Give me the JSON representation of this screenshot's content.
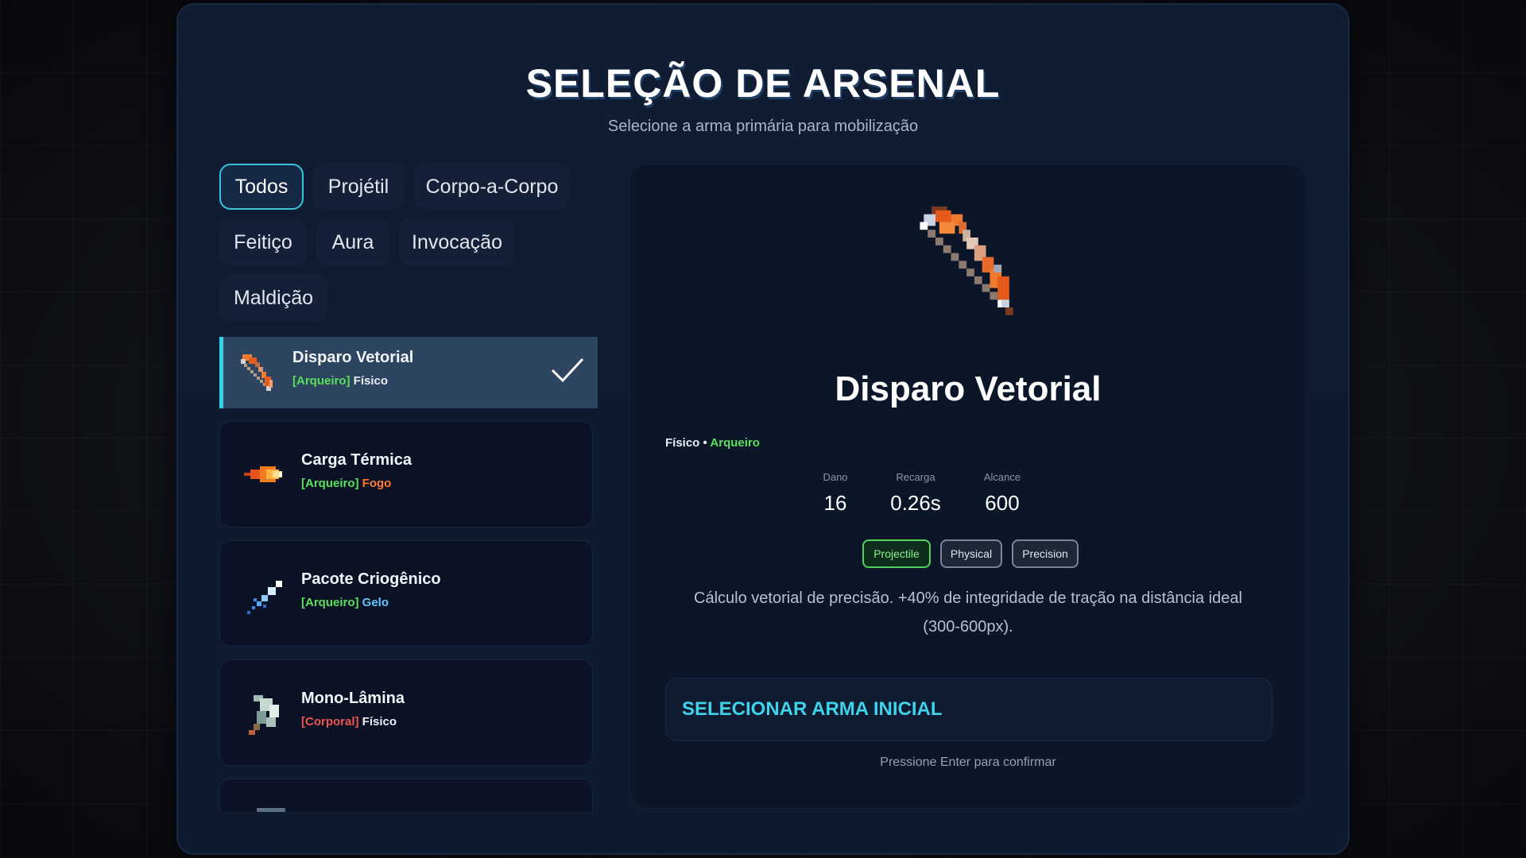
{
  "header": {
    "title": "SELEÇÃO DE ARSENAL",
    "subtitle": "Selecione a arma primária para mobilização"
  },
  "filters": [
    {
      "label": "Todos",
      "active": true
    },
    {
      "label": "Projétil",
      "active": false
    },
    {
      "label": "Corpo-a-Corpo",
      "active": false
    },
    {
      "label": "Feitiço",
      "active": false
    },
    {
      "label": "Aura",
      "active": false
    },
    {
      "label": "Invocação",
      "active": false
    },
    {
      "label": "Maldição",
      "active": false
    }
  ],
  "weapons": [
    {
      "name": "Disparo Vetorial",
      "class": "[Arqueiro]",
      "element": "Físico",
      "icon": "bow-icon",
      "selected": true
    },
    {
      "name": "Carga Térmica",
      "class": "[Arqueiro]",
      "element": "Fogo",
      "icon": "fireball-icon",
      "selected": false
    },
    {
      "name": "Pacote Criogênico",
      "class": "[Arqueiro]",
      "element": "Gelo",
      "icon": "ice-shard-icon",
      "selected": false
    },
    {
      "name": "Mono-Lâmina",
      "class": "[Corporal]",
      "element": "Físico",
      "icon": "blade-icon",
      "selected": false
    }
  ],
  "detail": {
    "name": "Disparo Vetorial",
    "element": "Físico",
    "separator": "•",
    "class": "Arqueiro",
    "icon": "bow-icon",
    "stats": [
      {
        "label": "Dano",
        "value": "16"
      },
      {
        "label": "Recarga",
        "value": "0.26s"
      },
      {
        "label": "Alcance",
        "value": "600"
      }
    ],
    "badges": [
      "Projectile",
      "Physical",
      "Precision"
    ],
    "description": "Cálculo vetorial de precisão. +40% de integridade de tração na distância ideal (300-600px).",
    "confirm_label": "SELECIONAR ARMA INICIAL",
    "hint": "Pressione Enter para confirmar"
  },
  "colors": {
    "accent": "#36d3e8",
    "class_archer": "#59e05a",
    "class_corporal": "#f0544f",
    "fire": "#ff7a2c",
    "ice": "#5fc6ff"
  }
}
